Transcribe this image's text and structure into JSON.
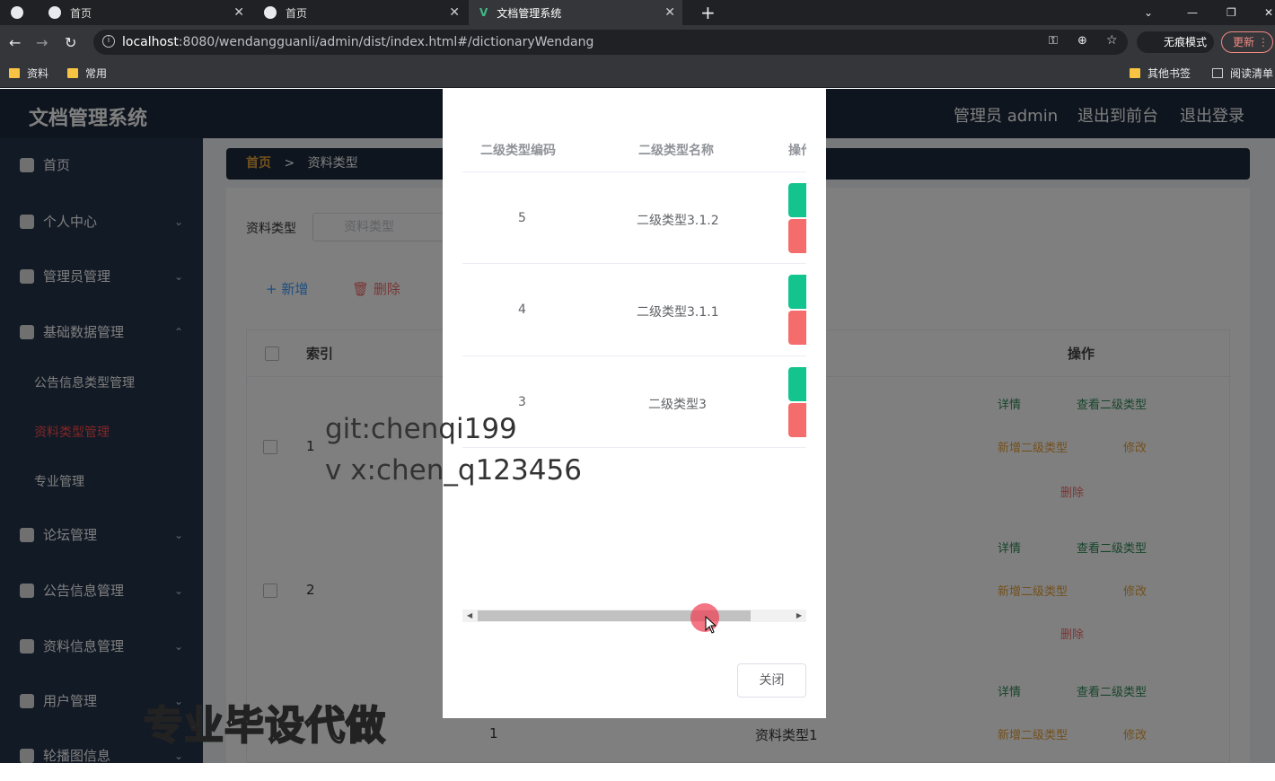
{
  "browser": {
    "tabs": [
      {
        "label": "首页"
      },
      {
        "label": "首页"
      },
      {
        "label": "文档管理系统"
      }
    ],
    "url_host": "localhost",
    "url_rest": ":8080/wendangguanli/admin/dist/index.html#/dictionaryWendang",
    "incognito_label": "无痕模式",
    "update_label": "更新",
    "bookmarks": [
      "资料",
      "常用"
    ],
    "bookmarks_right": [
      "其他书签",
      "阅读清单"
    ]
  },
  "app": {
    "brand": "文档管理系统",
    "top_right": [
      "管理员 admin",
      "退出到前台",
      "退出登录"
    ],
    "sidebar": [
      {
        "label": "首页"
      },
      {
        "label": "个人中心"
      },
      {
        "label": "管理员管理"
      },
      {
        "label": "基础数据管理"
      },
      {
        "label": "公告信息类型管理"
      },
      {
        "label": "资料类型管理"
      },
      {
        "label": "专业管理"
      },
      {
        "label": "论坛管理"
      },
      {
        "label": "公告信息管理"
      },
      {
        "label": "资料信息管理"
      },
      {
        "label": "用户管理"
      },
      {
        "label": "轮播图信息"
      }
    ],
    "breadcrumb_home": "首页",
    "breadcrumb_sep": ">",
    "breadcrumb_current": "资料类型",
    "search_label": "资料类型",
    "search_placeholder": "资料类型",
    "add_label": "+ 新增",
    "delete_label": "删除",
    "table_headers": {
      "index": "索引",
      "ops": "操作"
    },
    "rows": [
      {
        "no": "1"
      },
      {
        "no": "2"
      },
      {
        "no": "1",
        "name": "资料类型1"
      }
    ],
    "ops": {
      "detail": "详情",
      "view_sub": "查看二级类型",
      "add_sub": "新增二级类型",
      "edit": "修改",
      "delete": "删除"
    }
  },
  "modal": {
    "headers": [
      "二级类型编码",
      "二级类型名称",
      "操作"
    ],
    "rows": [
      {
        "code": "5",
        "name": "二级类型3.1.2"
      },
      {
        "code": "4",
        "name": "二级类型3.1.1"
      },
      {
        "code": "3",
        "name": "二级类型3"
      }
    ],
    "close_label": "关闭"
  },
  "watermark": {
    "line1": "git:chenqi199",
    "line2": "v x:chen_q123456",
    "caption": "专业毕设代做"
  }
}
